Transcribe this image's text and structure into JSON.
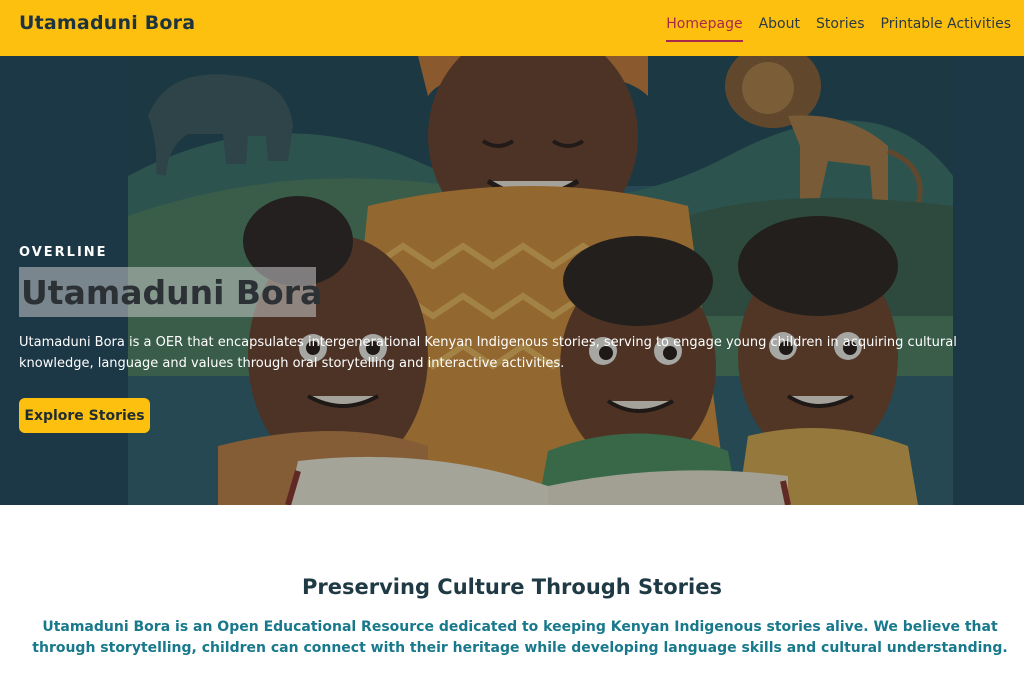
{
  "header": {
    "brand": "Utamaduni Bora",
    "nav": [
      {
        "label": "Homepage",
        "active": true
      },
      {
        "label": "About",
        "active": false
      },
      {
        "label": "Stories",
        "active": false
      },
      {
        "label": "Printable Activities",
        "active": false
      }
    ]
  },
  "hero": {
    "overline": "OVERLINE",
    "title": "Utamaduni Bora",
    "description": "Utamaduni Bora is a OER that encapsulates intergenerational Kenyan Indigenous stories, serving to engage young children in acquiring cultural knowledge, language and values through oral storytelling and interactive activities.",
    "cta_label": "Explore Stories",
    "image": "storytelling-illustration"
  },
  "intro": {
    "title": "Preserving Culture Through Stories",
    "text": "Utamaduni Bora is an Open Educational Resource dedicated to keeping Kenyan Indigenous stories alive. We believe that through storytelling, children can connect with their heritage while developing language skills and cultural understanding."
  },
  "colors": {
    "accent": "#fdc00f",
    "active_nav": "#a9284a",
    "hero_bg": "#214050",
    "intro_text": "#18788c"
  }
}
